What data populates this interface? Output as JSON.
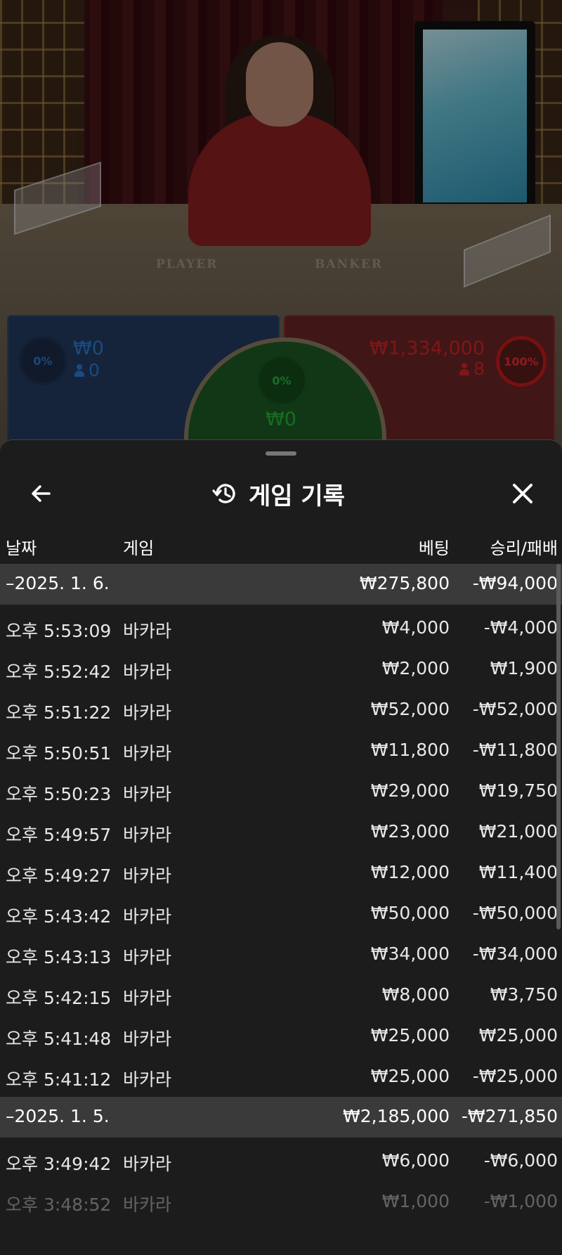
{
  "video": {
    "table_player": "PLAYER",
    "table_banker": "BANKER",
    "player": {
      "percent": "0%",
      "amount": "₩0",
      "players": "0"
    },
    "banker": {
      "percent": "100%",
      "amount": "₩1,334,000",
      "players": "8"
    },
    "tie": {
      "percent": "0%",
      "amount": "₩0"
    }
  },
  "history": {
    "title": "게임 기록",
    "icons": {
      "back": "arrow-left-icon",
      "history": "history-icon",
      "close": "close-icon"
    },
    "columns": {
      "date": "날짜",
      "game": "게임",
      "bet": "베팅",
      "result": "승리/패배"
    },
    "groups": [
      {
        "date": "–2025. 1. 6.",
        "bet_total": "₩275,800",
        "result_total": "-₩94,000",
        "rows": [
          {
            "time": "오후 5:53:09",
            "game": "바카라",
            "bet": "₩4,000",
            "result": "-₩4,000"
          },
          {
            "time": "오후 5:52:42",
            "game": "바카라",
            "bet": "₩2,000",
            "result": "₩1,900"
          },
          {
            "time": "오후 5:51:22",
            "game": "바카라",
            "bet": "₩52,000",
            "result": "-₩52,000"
          },
          {
            "time": "오후 5:50:51",
            "game": "바카라",
            "bet": "₩11,800",
            "result": "-₩11,800"
          },
          {
            "time": "오후 5:50:23",
            "game": "바카라",
            "bet": "₩29,000",
            "result": "₩19,750"
          },
          {
            "time": "오후 5:49:57",
            "game": "바카라",
            "bet": "₩23,000",
            "result": "₩21,000"
          },
          {
            "time": "오후 5:49:27",
            "game": "바카라",
            "bet": "₩12,000",
            "result": "₩11,400"
          },
          {
            "time": "오후 5:43:42",
            "game": "바카라",
            "bet": "₩50,000",
            "result": "-₩50,000"
          },
          {
            "time": "오후 5:43:13",
            "game": "바카라",
            "bet": "₩34,000",
            "result": "-₩34,000"
          },
          {
            "time": "오후 5:42:15",
            "game": "바카라",
            "bet": "₩8,000",
            "result": "₩3,750"
          },
          {
            "time": "오후 5:41:48",
            "game": "바카라",
            "bet": "₩25,000",
            "result": "₩25,000"
          },
          {
            "time": "오후 5:41:12",
            "game": "바카라",
            "bet": "₩25,000",
            "result": "-₩25,000"
          }
        ]
      },
      {
        "date": "–2025. 1. 5.",
        "bet_total": "₩2,185,000",
        "result_total": "-₩271,850",
        "rows": [
          {
            "time": "오후 3:49:42",
            "game": "바카라",
            "bet": "₩6,000",
            "result": "-₩6,000"
          },
          {
            "time": "오후 3:48:52",
            "game": "바카라",
            "bet": "₩1,000",
            "result": "-₩1,000"
          }
        ]
      }
    ]
  }
}
